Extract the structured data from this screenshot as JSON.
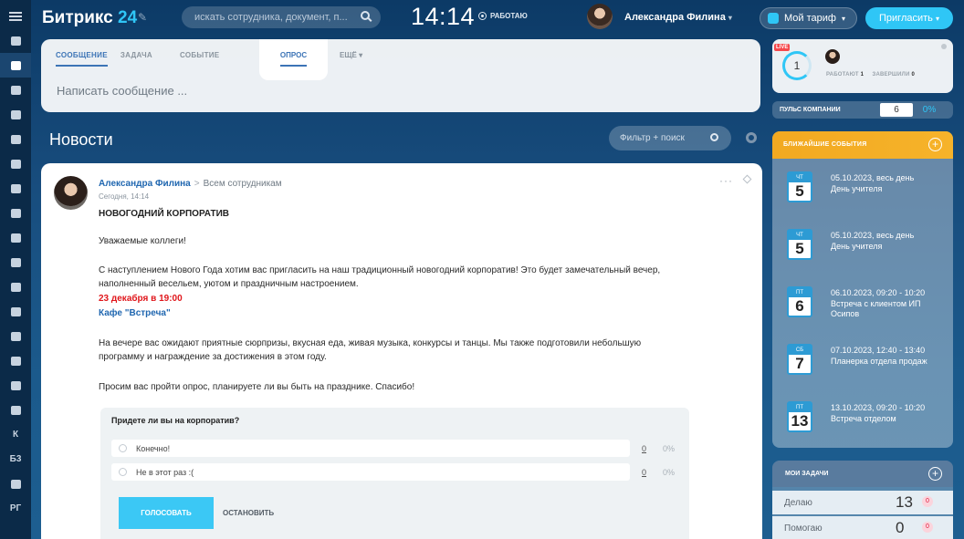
{
  "sidebar": {
    "items": [
      "",
      "",
      "",
      "",
      "",
      "",
      "",
      "",
      "",
      "",
      "",
      "",
      "",
      "",
      "",
      "",
      ""
    ],
    "text_items": [
      "К",
      "Б3",
      "",
      "РГ"
    ]
  },
  "header": {
    "logo_text": "Битрикс",
    "logo_num": "24",
    "search_placeholder": "искать сотрудника, документ, п...",
    "time": "14:14",
    "status": "РАБОТАЮ",
    "user_name": "Александра Филина",
    "tariff_label": "Мой тариф",
    "invite_label": "Пригласить"
  },
  "composer": {
    "tabs": [
      "СООБЩЕНИЕ",
      "ЗАДАЧА",
      "СОБЫТИЕ",
      "ОПРОС",
      "ЕЩЁ ▾"
    ],
    "placeholder": "Написать сообщение ..."
  },
  "news": {
    "title": "Новости",
    "filter_placeholder": "Фильтр + поиск"
  },
  "post": {
    "author": "Александра Филина",
    "arrow": ">",
    "destination": "Всем сотрудникам",
    "date": "Сегодня, 14:14",
    "title": "НОВОГОДНИЙ КОРПОРАТИВ",
    "greeting": "Уважаемые коллеги!",
    "para1": "С наступлением Нового Года хотим вас пригласить на наш традиционный новогодний корпоратив! Это будет замечательный вечер, наполненный весельем, уютом и праздничным настроением.",
    "when": "23 декабря в 19:00",
    "where": "Кафе \"Встреча\"",
    "para2": "На вечере вас ожидают приятные сюрпризы, вкусная еда, живая музыка, конкурсы и танцы. Мы также подготовили небольшую программу и награждение за достижения в этом году.",
    "para3": "Просим вас пройти опрос, планируете ли вы быть на празднике. Спасибо!"
  },
  "poll": {
    "question": "Придете ли вы на корпоратив?",
    "options": [
      {
        "label": "Конечно!",
        "count": "0",
        "pct": "0%"
      },
      {
        "label": "Не в этот раз :(",
        "count": "0",
        "pct": "0%"
      }
    ],
    "vote_label": "ГОЛОСОВАТЬ",
    "stop_label": "ОСТАНОВИТЬ"
  },
  "live": {
    "badge": "LIVE",
    "count": "1",
    "working_label": "РАБОТАЮТ",
    "working_count": "1",
    "finished_label": "ЗАВЕРШИЛИ",
    "finished_count": "0"
  },
  "pulse": {
    "label": "ПУЛЬС КОМПАНИИ",
    "value": "6",
    "pct": "0%"
  },
  "events": {
    "title": "БЛИЖАЙШИЕ СОБЫТИЯ",
    "items": [
      {
        "dow": "ЧТ",
        "day": "5",
        "date": "05.10.2023, весь день",
        "name": "День учителя"
      },
      {
        "dow": "ЧТ",
        "day": "5",
        "date": "05.10.2023, весь день",
        "name": "День учителя"
      },
      {
        "dow": "ПТ",
        "day": "6",
        "date": "06.10.2023, 09:20 - 10:20",
        "name": "Встреча с клиентом ИП Осипов"
      },
      {
        "dow": "СБ",
        "day": "7",
        "date": "07.10.2023, 12:40 - 13:40",
        "name": "Планерка отдела продаж"
      },
      {
        "dow": "ПТ",
        "day": "13",
        "date": "13.10.2023, 09:20 - 10:20",
        "name": "Встреча отделом"
      }
    ]
  },
  "tasks": {
    "title": "МОИ ЗАДАЧИ",
    "rows": [
      {
        "label": "Делаю",
        "count": "13",
        "badge": "0"
      },
      {
        "label": "Помогаю",
        "count": "0",
        "badge": "0"
      }
    ]
  },
  "colors": {
    "accent": "#2fc6f6",
    "link": "#2067b0",
    "alert": "#e0161b",
    "events_header": "#f2a921"
  }
}
